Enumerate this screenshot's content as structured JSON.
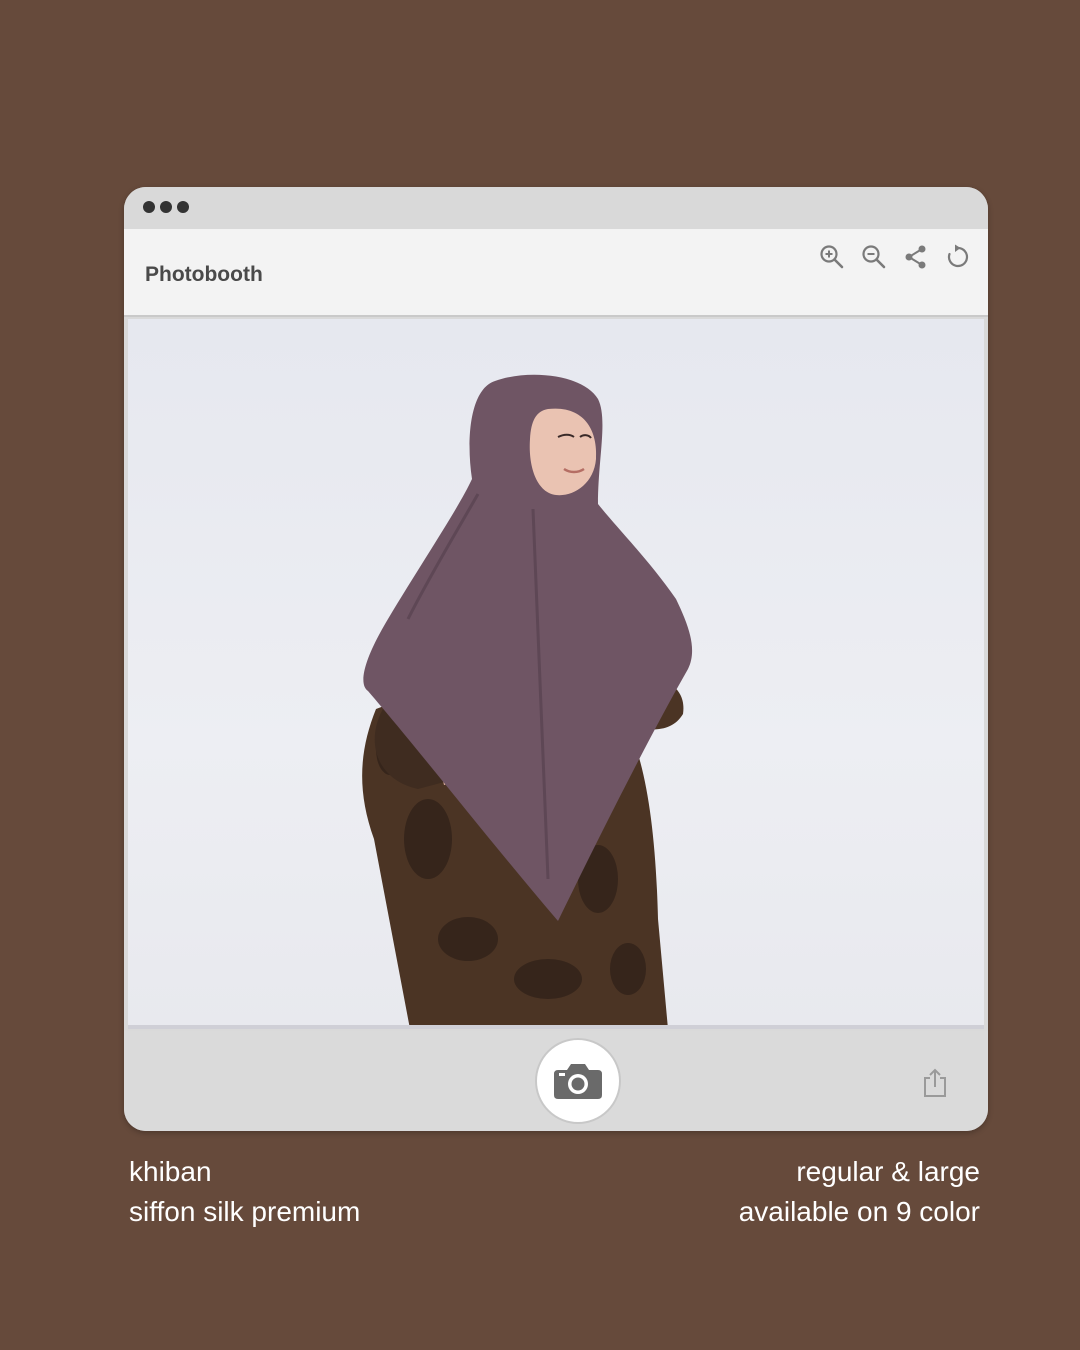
{
  "window": {
    "title": "Photobooth",
    "tools": [
      "zoom-in-icon",
      "zoom-out-icon",
      "share-icon",
      "refresh-icon"
    ]
  },
  "photo": {
    "description": "model-in-mauve-khimar",
    "hijab_color": "#6f5564",
    "dress_color": "#4b3424"
  },
  "caption": {
    "left_line1": "khiban",
    "left_line2": "siffon silk premium",
    "right_line1": "regular & large",
    "right_line2": "available on 9 color"
  },
  "colors": {
    "background": "#664a3b",
    "window": "#d9d9d9",
    "toolbar": "#f3f3f3"
  }
}
